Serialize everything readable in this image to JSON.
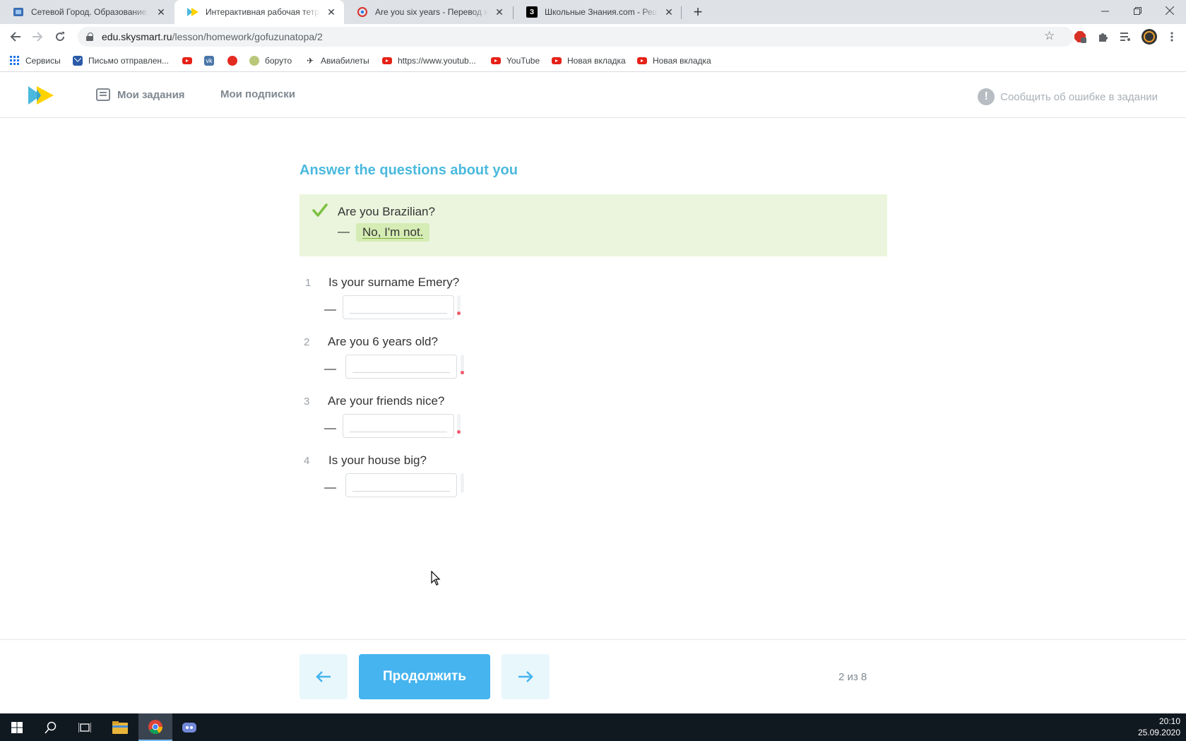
{
  "browser": {
    "tabs": [
      {
        "title": "Сетевой Город. Образование. Д",
        "icon": "netcity-favicon",
        "active": false
      },
      {
        "title": "Интерактивная рабочая тетрадь",
        "icon": "skysmart-favicon",
        "active": true
      },
      {
        "title": "Are you six years - Перевод на р",
        "icon": "translate-favicon",
        "active": false
      },
      {
        "title": "Школьные Знания.com - Решае",
        "icon": "znanija-favicon",
        "active": false
      }
    ],
    "new_tab": "+",
    "url_domain": "edu.skysmart.ru",
    "url_path": "/lesson/homework/gofuzunatopa/2",
    "bookmarks": [
      {
        "label": "Сервисы",
        "icon": "apps-icon"
      },
      {
        "label": "Письмо отправлен...",
        "icon": "mail-icon"
      },
      {
        "label": "",
        "icon": "youtube-icon"
      },
      {
        "label": "",
        "icon": "vk-icon"
      },
      {
        "label": "",
        "icon": "red-dot-icon"
      },
      {
        "label": "боруто",
        "icon": "boruto-icon"
      },
      {
        "label": "Авиабилеты",
        "icon": "plane-icon"
      },
      {
        "label": "https://www.youtub...",
        "icon": "youtube-icon"
      },
      {
        "label": "YouTube",
        "icon": "youtube-icon"
      },
      {
        "label": "Новая вкладка",
        "icon": "youtube-icon"
      },
      {
        "label": "Новая вкладка",
        "icon": "youtube-icon"
      }
    ]
  },
  "header": {
    "nav": [
      "Мои задания",
      "Мои подписки"
    ],
    "report": "Сообщить об ошибке в задании"
  },
  "exercise": {
    "title": "Answer the questions about you",
    "example": {
      "question": "Are you Brazilian?",
      "dash": "—",
      "answer": "No, I'm not."
    },
    "questions": [
      {
        "num": "1",
        "text": "Is your surname Emery?",
        "dash": "—",
        "value": "",
        "status": "error"
      },
      {
        "num": "2",
        "text": "Are you 6 years old?",
        "dash": "—",
        "value": "",
        "status": "error"
      },
      {
        "num": "3",
        "text": "Are your friends nice?",
        "dash": "—",
        "value": "",
        "status": "error"
      },
      {
        "num": "4",
        "text": "Is your house big?",
        "dash": "—",
        "value": "",
        "status": "empty"
      }
    ]
  },
  "footer": {
    "prev_arrow": "←",
    "continue": "Продолжить",
    "next_arrow": "→",
    "counter": "2 из 8"
  },
  "colors": {
    "accent": "#45b4ef",
    "title": "#4ab9dd",
    "example_bg": "#ebf5dd",
    "check": "#7cc242",
    "error": "#f05a6b"
  },
  "taskbar": {
    "time": "20:10",
    "date": "25.09.2020"
  }
}
